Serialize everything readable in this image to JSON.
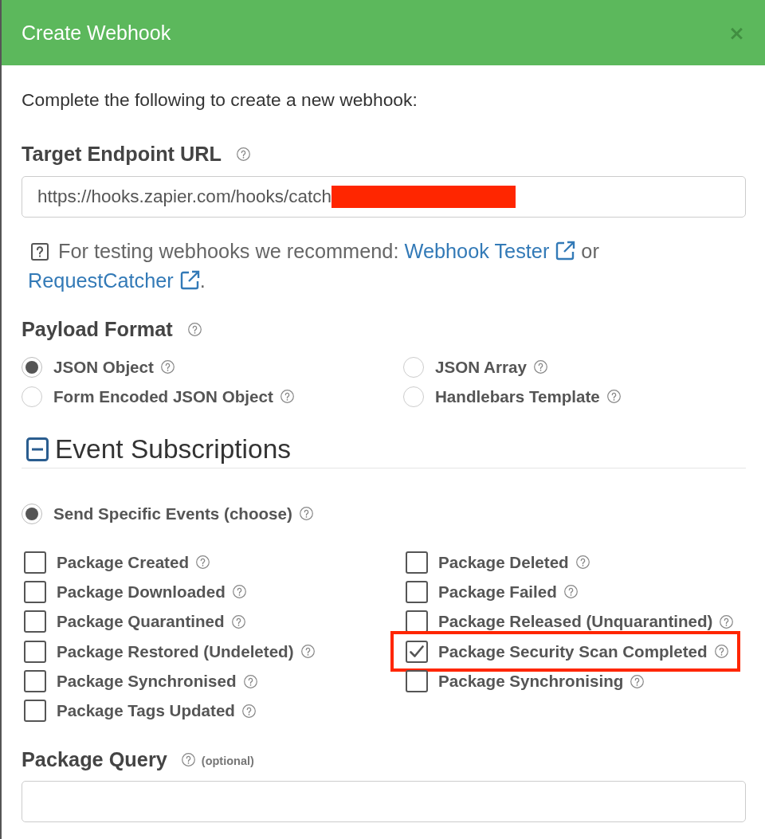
{
  "dialog": {
    "title": "Create Webhook",
    "close_symbol": "×"
  },
  "intro": "Complete the following to create a new webhook:",
  "target_url": {
    "label": "Target Endpoint URL",
    "value": "https://hooks.zapier.com/hooks/catch",
    "redacted": true
  },
  "testing_hint": [
    {
      "kind": "text",
      "text": "For testing webhooks we recommend: "
    },
    {
      "kind": "link",
      "text": "Webhook Tester"
    },
    {
      "kind": "text",
      "text": " or "
    },
    {
      "kind": "link",
      "text": "RequestCatcher"
    },
    {
      "kind": "text",
      "text": "."
    }
  ],
  "payload_format": {
    "label": "Payload Format",
    "options": [
      {
        "label": "JSON Object",
        "selected": true
      },
      {
        "label": "JSON Array",
        "selected": false
      },
      {
        "label": "Form Encoded JSON Object",
        "selected": false
      },
      {
        "label": "Handlebars Template",
        "selected": false
      }
    ]
  },
  "event_subscriptions": {
    "title": "Event Subscriptions",
    "expanded": true,
    "mode": {
      "label": "Send Specific Events (choose)",
      "selected": true
    },
    "events": [
      {
        "label": "Package Created",
        "checked": false,
        "highlighted": false
      },
      {
        "label": "Package Deleted",
        "checked": false,
        "highlighted": false
      },
      {
        "label": "Package Downloaded",
        "checked": false,
        "highlighted": false
      },
      {
        "label": "Package Failed",
        "checked": false,
        "highlighted": false
      },
      {
        "label": "Package Quarantined",
        "checked": false,
        "highlighted": false
      },
      {
        "label": "Package Released (Unquarantined)",
        "checked": false,
        "highlighted": false
      },
      {
        "label": "Package Restored (Undeleted)",
        "checked": false,
        "highlighted": false
      },
      {
        "label": "Package Security Scan Completed",
        "checked": true,
        "highlighted": true
      },
      {
        "label": "Package Synchronised",
        "checked": false,
        "highlighted": false
      },
      {
        "label": "Package Synchronising",
        "checked": false,
        "highlighted": false
      },
      {
        "label": "Package Tags Updated",
        "checked": false,
        "highlighted": false
      }
    ]
  },
  "package_query": {
    "label": "Package Query",
    "note": "(optional)"
  }
}
